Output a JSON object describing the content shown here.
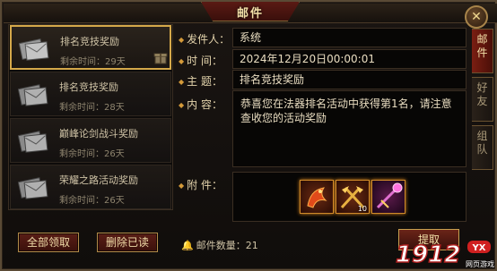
{
  "window": {
    "title": "邮件",
    "close_glyph": "✕"
  },
  "mail_list": [
    {
      "title": "排名竞技奖励",
      "time": "剩余时间：29天",
      "selected": true,
      "has_gift": true
    },
    {
      "title": "排名竞技奖励",
      "time": "剩余时间：28天",
      "selected": false,
      "has_gift": false
    },
    {
      "title": "巅峰论剑战斗奖励",
      "time": "剩余时间：26天",
      "selected": false,
      "has_gift": false
    },
    {
      "title": "荣耀之路活动奖励",
      "time": "剩余时间：26天",
      "selected": false,
      "has_gift": false
    }
  ],
  "buttons": {
    "receive_all": "全部领取",
    "delete_read": "删除已读",
    "receive": "提取"
  },
  "detail": {
    "sender_label": "发件人：",
    "sender": "系统",
    "time_label": "时  间：",
    "time": "2024年12月20日00:00:01",
    "subject_label": "主  题：",
    "subject": "排名竞技奖励",
    "content_label": "内  容：",
    "content": "恭喜您在法器排名活动中获得第1名，请注意查收您的活动奖励",
    "attachment_label": "附  件：",
    "attachments": [
      {
        "icon": "red-dragon-item-icon",
        "count": ""
      },
      {
        "icon": "golden-axes-item-icon",
        "count": "10"
      },
      {
        "icon": "purple-staff-item-icon",
        "count": ""
      }
    ]
  },
  "mail_count_label": "邮件数量：",
  "mail_count": "21",
  "side_tabs": [
    {
      "label": "邮件",
      "active": true
    },
    {
      "label": "好友",
      "active": false
    },
    {
      "label": "组队",
      "active": false
    }
  ],
  "watermark": {
    "number": "1912",
    "sub": "网页游戏",
    "badge": "YX"
  },
  "colors": {
    "accent_gold": "#d4a84a",
    "button_red": "#5a1e16",
    "tab_active": "#7a1e12"
  }
}
